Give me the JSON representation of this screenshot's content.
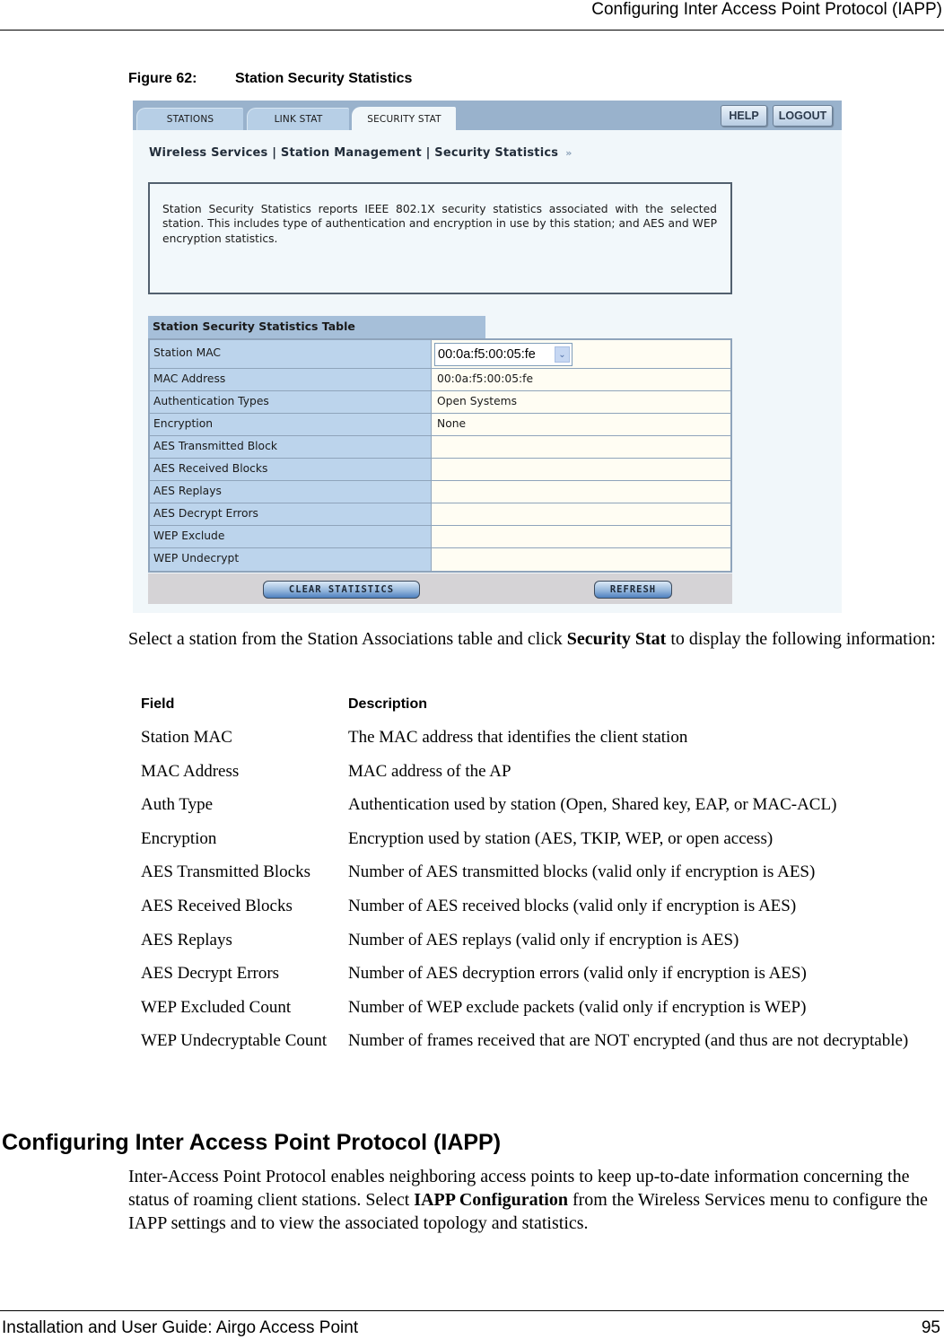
{
  "running_header": "Configuring Inter Access Point Protocol (IAPP)",
  "figure": {
    "number": "Figure 62:",
    "title": "Station Security Statistics"
  },
  "screenshot": {
    "tabs": [
      {
        "label": "STATIONS",
        "active": false
      },
      {
        "label": "LINK STAT",
        "active": false
      },
      {
        "label": "SECURITY STAT",
        "active": true
      }
    ],
    "top_buttons": {
      "help": "HELP",
      "logout": "LOGOUT"
    },
    "breadcrumb": "Wireless Services | Station Management | Security Statistics",
    "breadcrumb_icon": "double-chevron-right-icon",
    "breadcrumb_arrows": "»",
    "info_text": "Station Security Statistics reports IEEE 802.1X security statistics associated with the selected station. This includes type of authentication and encryption in use by this station; and AES and WEP encryption statistics.",
    "table_title": "Station Security Statistics Table",
    "rows": [
      {
        "label": "Station MAC",
        "value": "00:0a:f5:00:05:fe"
      },
      {
        "label": "MAC Address",
        "value": "00:0a:f5:00:05:fe"
      },
      {
        "label": "Authentication Types",
        "value": "Open Systems"
      },
      {
        "label": "Encryption",
        "value": "None"
      },
      {
        "label": "AES Transmitted Block",
        "value": ""
      },
      {
        "label": "AES Received Blocks",
        "value": ""
      },
      {
        "label": "AES Replays",
        "value": ""
      },
      {
        "label": "AES Decrypt Errors",
        "value": ""
      },
      {
        "label": "WEP Exclude",
        "value": ""
      },
      {
        "label": "WEP Undecrypt",
        "value": ""
      }
    ],
    "select_chevron": "⌄",
    "buttons": {
      "clear": "CLEAR STATISTICS",
      "refresh": "REFRESH"
    }
  },
  "intro": {
    "before": "Select a station from the Station Associations table and click ",
    "bold": "Security Stat",
    "after": " to display the following information:"
  },
  "field_table": {
    "headers": {
      "field": "Field",
      "description": "Description"
    },
    "rows": [
      {
        "field": "Station MAC",
        "description": "The MAC address that identifies the client station"
      },
      {
        "field": "MAC Address",
        "description": "MAC address of the AP"
      },
      {
        "field": "Auth Type",
        "description": "Authentication used by station (Open, Shared key, EAP, or MAC-ACL)"
      },
      {
        "field": "Encryption",
        "description": "Encryption used by station (AES, TKIP, WEP, or open access)"
      },
      {
        "field": "AES Transmitted Blocks",
        "description": "Number of AES transmitted blocks (valid only if encryption is AES)"
      },
      {
        "field": "AES Received Blocks",
        "description": "Number of AES received blocks (valid only if encryption is AES)"
      },
      {
        "field": "AES Replays",
        "description": "Number of AES replays (valid only if encryption is AES)"
      },
      {
        "field": "AES Decrypt Errors",
        "description": "Number of AES decryption errors (valid only if encryption is AES)"
      },
      {
        "field": "WEP Excluded Count",
        "description": "Number of WEP exclude packets (valid only if encryption is WEP)"
      },
      {
        "field": "WEP Undecryptable Count",
        "description": "Number of frames received that are NOT encrypted (and thus are not decryptable)"
      }
    ]
  },
  "section": {
    "title": "Configuring Inter Access Point Protocol (IAPP)",
    "body_before": "Inter-Access Point Protocol enables neighboring access points to keep up-to-date information concerning the status of roaming client stations. Select ",
    "body_bold": "IAPP Configuration",
    "body_after": " from the Wireless Services menu to configure the IAPP settings and to view the associated topology and statistics."
  },
  "footer": {
    "guide": "Installation and User Guide: Airgo Access Point",
    "page": "95"
  }
}
